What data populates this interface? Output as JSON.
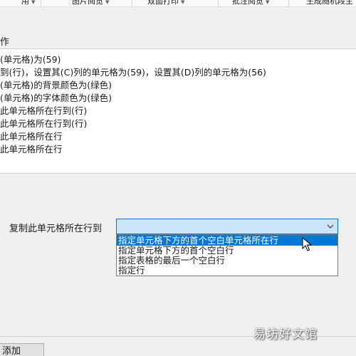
{
  "toolbar": {
    "items": [
      {
        "label": "用",
        "dropdown": true
      },
      {
        "label": "图片阅览",
        "dropdown": true
      },
      {
        "label": "双面打印",
        "dropdown": true
      },
      {
        "label": "批注阅览",
        "dropdown": true
      },
      {
        "label": "生成随机段主",
        "dropdown": false
      }
    ]
  },
  "actions": {
    "section_label": "作",
    "items": [
      "(单元格)为(59)",
      "到(行)，设置其(C)列的单元格为(59)，设置其(D)列的单元格为(56)",
      "(单元格)的背景颜色为(绿色)",
      "(单元格)的字体颜色为(绿色)",
      "此单元格所在行到(行)",
      "此单元格所在行到(行)",
      "此单元格所在行",
      "此单元格所在行"
    ]
  },
  "settings": {
    "copy_row_label": "复制此单元格所在行到",
    "combo_value": "",
    "options": [
      "指定单元格下方的首个空白单元格所在行",
      "指定单元格下方的首个空白行",
      "指定表格的最后一个空白行",
      "指定行"
    ],
    "selected_index": 0
  },
  "footer": {
    "add_button_label": "添加"
  },
  "watermark": "易坊好文馆"
}
